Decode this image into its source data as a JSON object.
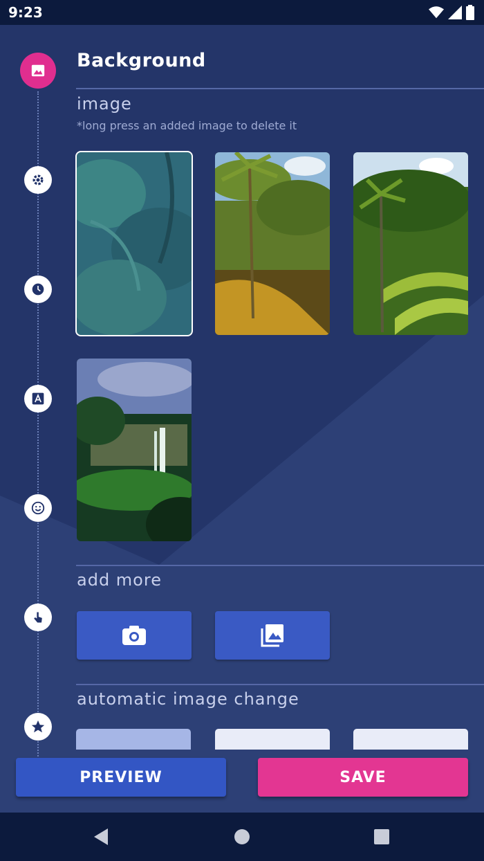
{
  "status_bar": {
    "time": "9:23",
    "icons": [
      "wifi-icon",
      "signal-icon",
      "battery-icon"
    ]
  },
  "page": {
    "title": "Background",
    "image_section": {
      "label": "image",
      "hint": "*long press an added image to delete it"
    },
    "images": [
      {
        "name": "jungle-foliage",
        "selected": true
      },
      {
        "name": "palm-trees",
        "selected": false
      },
      {
        "name": "rice-terraces",
        "selected": false
      },
      {
        "name": "waterfall",
        "selected": false
      }
    ],
    "add_more": {
      "label": "add more",
      "buttons": [
        "camera-icon",
        "photo-library-icon"
      ]
    },
    "auto_change": {
      "label": "automatic image change"
    }
  },
  "timeline": {
    "icons": [
      "image-icon",
      "gear-icon",
      "clock-icon",
      "text-icon",
      "smiley-icon",
      "touch-icon",
      "star-icon"
    ]
  },
  "actions": {
    "preview_label": "PREVIEW",
    "save_label": "SAVE"
  },
  "navbar": {
    "icons": [
      "back-icon",
      "home-icon",
      "recents-icon"
    ]
  },
  "colors": {
    "accent": "#e33692",
    "primary": "#3356c4",
    "background": "#243569"
  }
}
